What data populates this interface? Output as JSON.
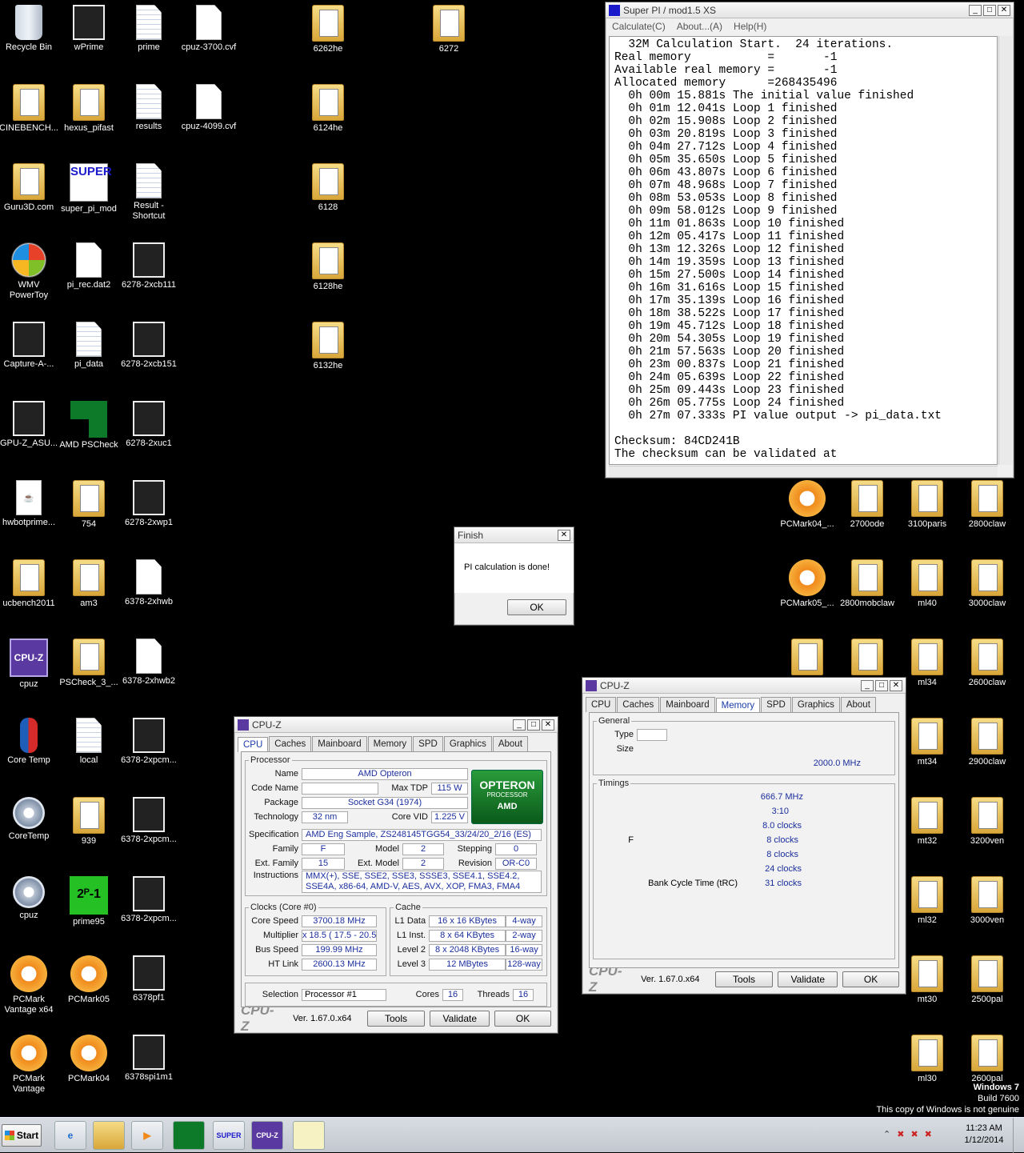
{
  "desktop": {
    "icons": [
      {
        "label": "Recycle Bin",
        "icon": "recycle-bin-icon"
      },
      {
        "label": "wPrime",
        "icon": "wprime-icon"
      },
      {
        "label": "prime",
        "icon": "text-file-icon"
      },
      {
        "label": "cpuz-3700.cvf",
        "icon": "file-icon"
      },
      {
        "label": "6262he",
        "icon": "folder-icon"
      },
      {
        "label": "6272",
        "icon": "folder-icon"
      },
      {
        "label": "CINEBENCH...",
        "icon": "folder-icon"
      },
      {
        "label": "hexus_pifast",
        "icon": "folder-icon"
      },
      {
        "label": "results",
        "icon": "text-file-icon"
      },
      {
        "label": "cpuz-4099.cvf",
        "icon": "file-icon"
      },
      {
        "label": "6124he",
        "icon": "folder-icon"
      },
      {
        "label": "Guru3D.com",
        "icon": "folder-icon"
      },
      {
        "label": "super_pi_mod",
        "icon": "super-pi-icon"
      },
      {
        "label": "Result - Shortcut",
        "icon": "shortcut-icon"
      },
      {
        "label": "6128",
        "icon": "folder-icon"
      },
      {
        "label": "WMV PowerToy",
        "icon": "windows-logo-icon"
      },
      {
        "label": "pi_rec.dat2",
        "icon": "file-icon"
      },
      {
        "label": "6278-2xcb111",
        "icon": "image-icon"
      },
      {
        "label": "6128he",
        "icon": "folder-icon"
      },
      {
        "label": "Capture-A-...",
        "icon": "capture-icon"
      },
      {
        "label": "pi_data",
        "icon": "text-file-icon"
      },
      {
        "label": "6278-2xcb151",
        "icon": "image-icon"
      },
      {
        "label": "6132he",
        "icon": "folder-icon"
      },
      {
        "label": "GPU-Z_ASU...",
        "icon": "gpuz-icon"
      },
      {
        "label": "AMD PSCheck",
        "icon": "amd-icon"
      },
      {
        "label": "6278-2xuc1",
        "icon": "image-icon"
      },
      {
        "label": "hwbotprime...",
        "icon": "java-icon"
      },
      {
        "label": "754",
        "icon": "folder-icon"
      },
      {
        "label": "6278-2xwp1",
        "icon": "image-icon"
      },
      {
        "label": "ucbench2011",
        "icon": "folder-icon"
      },
      {
        "label": "am3",
        "icon": "folder-icon"
      },
      {
        "label": "6378-2xhwb",
        "icon": "file-icon"
      },
      {
        "label": "cpuz",
        "icon": "cpuz-icon"
      },
      {
        "label": "PSCheck_3_...",
        "icon": "folder-icon"
      },
      {
        "label": "6378-2xhwb2",
        "icon": "file-icon"
      },
      {
        "label": "Core Temp",
        "icon": "thermometer-icon"
      },
      {
        "label": "local",
        "icon": "text-file-icon"
      },
      {
        "label": "6378-2xpcm...",
        "icon": "image-icon"
      },
      {
        "label": "CoreTemp",
        "icon": "gear-icon"
      },
      {
        "label": "939",
        "icon": "folder-icon"
      },
      {
        "label": "6378-2xpcm...",
        "icon": "image-icon"
      },
      {
        "label": "cpuz",
        "icon": "gear-icon"
      },
      {
        "label": "prime95",
        "icon": "prime95-icon"
      },
      {
        "label": "6378-2xpcm...",
        "icon": "image-icon"
      },
      {
        "label": "PCMark Vantage x64",
        "icon": "pcmark-icon"
      },
      {
        "label": "PCMark05",
        "icon": "pcmark-icon"
      },
      {
        "label": "6378pf1",
        "icon": "image-icon"
      },
      {
        "label": "PCMark Vantage",
        "icon": "pcmark-icon"
      },
      {
        "label": "PCMark04",
        "icon": "pcmark-icon"
      },
      {
        "label": "6378spi1m1",
        "icon": "image-icon"
      },
      {
        "label": "PCMark04_...",
        "icon": "pcmark-icon"
      },
      {
        "label": "2700ode",
        "icon": "folder-icon"
      },
      {
        "label": "3100paris",
        "icon": "folder-icon"
      },
      {
        "label": "2800claw",
        "icon": "folder-icon"
      },
      {
        "label": "PCMark05_...",
        "icon": "pcmark-icon"
      },
      {
        "label": "2800mobclaw",
        "icon": "folder-icon"
      },
      {
        "label": "ml40",
        "icon": "folder-icon"
      },
      {
        "label": "3000claw",
        "icon": "folder-icon"
      },
      {
        "label": "ml34",
        "icon": "folder-icon"
      },
      {
        "label": "2600claw",
        "icon": "folder-icon"
      },
      {
        "label": "mt34",
        "icon": "folder-icon"
      },
      {
        "label": "2900claw",
        "icon": "folder-icon"
      },
      {
        "label": "mt32",
        "icon": "folder-icon"
      },
      {
        "label": "3200ven",
        "icon": "folder-icon"
      },
      {
        "label": "ml32",
        "icon": "folder-icon"
      },
      {
        "label": "3000ven",
        "icon": "folder-icon"
      },
      {
        "label": "mt30",
        "icon": "folder-icon"
      },
      {
        "label": "2500pal",
        "icon": "folder-icon"
      },
      {
        "label": "ml30",
        "icon": "folder-icon"
      },
      {
        "label": "2600pal",
        "icon": "folder-icon"
      },
      {
        "label": "",
        "icon": "folder-icon"
      },
      {
        "label": "",
        "icon": "folder-icon"
      }
    ],
    "watermark": {
      "line1": "Windows 7",
      "line2": "Build 7600",
      "line3": "This copy of Windows is not genuine"
    }
  },
  "superpi": {
    "title": "Super PI / mod1.5 XS",
    "menu": [
      "Calculate(C)",
      "About...(A)",
      "Help(H)"
    ],
    "lines": [
      "  32M Calculation Start.  24 iterations.",
      "Real memory           =       -1",
      "Available real memory =       -1",
      "Allocated memory      =268435496",
      "  0h 00m 15.881s The initial value finished",
      "  0h 01m 12.041s Loop 1 finished",
      "  0h 02m 15.908s Loop 2 finished",
      "  0h 03m 20.819s Loop 3 finished",
      "  0h 04m 27.712s Loop 4 finished",
      "  0h 05m 35.650s Loop 5 finished",
      "  0h 06m 43.807s Loop 6 finished",
      "  0h 07m 48.968s Loop 7 finished",
      "  0h 08m 53.053s Loop 8 finished",
      "  0h 09m 58.012s Loop 9 finished",
      "  0h 11m 01.863s Loop 10 finished",
      "  0h 12m 05.417s Loop 11 finished",
      "  0h 13m 12.326s Loop 12 finished",
      "  0h 14m 19.359s Loop 13 finished",
      "  0h 15m 27.500s Loop 14 finished",
      "  0h 16m 31.616s Loop 15 finished",
      "  0h 17m 35.139s Loop 16 finished",
      "  0h 18m 38.522s Loop 17 finished",
      "  0h 19m 45.712s Loop 18 finished",
      "  0h 20m 54.305s Loop 19 finished",
      "  0h 21m 57.563s Loop 20 finished",
      "  0h 23m 00.837s Loop 21 finished",
      "  0h 24m 05.639s Loop 22 finished",
      "  0h 25m 09.443s Loop 23 finished",
      "  0h 26m 05.775s Loop 24 finished",
      "  0h 27m 07.333s PI value output -> pi_data.txt",
      "",
      "Checksum: 84CD241B",
      "The checksum can be validated at"
    ]
  },
  "finish": {
    "title": "Finish",
    "message": "PI calculation is done!",
    "ok": "OK"
  },
  "cpuz1": {
    "title": "CPU-Z",
    "tabs": [
      "CPU",
      "Caches",
      "Mainboard",
      "Memory",
      "SPD",
      "Graphics",
      "About"
    ],
    "processor_legend": "Processor",
    "name_l": "Name",
    "name": "AMD Opteron",
    "codename_l": "Code Name",
    "codename": "",
    "tdp_l": "Max TDP",
    "tdp": "115 W",
    "package_l": "Package",
    "package": "Socket G34 (1974)",
    "tech_l": "Technology",
    "tech": "32 nm",
    "vid_l": "Core VID",
    "vid": "1.225 V",
    "spec_l": "Specification",
    "spec": "AMD Eng Sample, ZS248145TGG54_33/24/20_2/16    (ES)",
    "family_l": "Family",
    "family": "F",
    "model_l": "Model",
    "model": "2",
    "stepping_l": "Stepping",
    "stepping": "0",
    "extfamily_l": "Ext. Family",
    "extfamily": "15",
    "extmodel_l": "Ext. Model",
    "extmodel": "2",
    "revision_l": "Revision",
    "revision": "OR-C0",
    "instr_l": "Instructions",
    "instr": "MMX(+), SSE, SSE2, SSE3, SSSE3, SSE4.1, SSE4.2, SSE4A, x86-64, AMD-V, AES, AVX, XOP, FMA3, FMA4",
    "badge_top": "OPTERON",
    "badge_mid": "PROCESSOR",
    "badge_amd": "AMD",
    "clocks_legend": "Clocks (Core #0)",
    "speed_l": "Core Speed",
    "speed": "3700.18 MHz",
    "mult_l": "Multiplier",
    "mult": "x 18.5 ( 17.5 - 20.5 )",
    "bus_l": "Bus Speed",
    "bus": "199.99 MHz",
    "ht_l": "HT Link",
    "ht": "2600.13 MHz",
    "cache_legend": "Cache",
    "l1d_l": "L1 Data",
    "l1d": "16 x 16 KBytes",
    "l1d_w": "4-way",
    "l1i_l": "L1 Inst.",
    "l1i": "8 x 64 KBytes",
    "l1i_w": "2-way",
    "l2_l": "Level 2",
    "l2": "8 x 2048 KBytes",
    "l2_w": "16-way",
    "l3_l": "Level 3",
    "l3": "12 MBytes",
    "l3_w": "128-way",
    "sel_l": "Selection",
    "sel": "Processor #1",
    "cores_l": "Cores",
    "cores": "16",
    "threads_l": "Threads",
    "threads": "16",
    "logo": "CPU-Z",
    "ver": "Ver. 1.67.0.x64",
    "tools": "Tools",
    "validate": "Validate",
    "ok": "OK"
  },
  "cpuz2": {
    "title": "CPU-Z",
    "tabs": [
      "CPU",
      "Caches",
      "Mainboard",
      "Memory",
      "SPD",
      "Graphics",
      "About"
    ],
    "general_legend": "General",
    "type_l": "Type",
    "size_l": "Size",
    "nb_freq": "2000.0 MHz",
    "timings_legend": "Timings",
    "dram_freq": "666.7 MHz",
    "ratio": "3:10",
    "cl": "8.0 clocks",
    "f_label": "F",
    "trcd": "8 clocks",
    "trp": "8 clocks",
    "tras": "24 clocks",
    "trc_l": "Bank Cycle Time (tRC)",
    "trc": "31 clocks",
    "logo": "CPU-Z",
    "ver": "Ver. 1.67.0.x64",
    "tools": "Tools",
    "validate": "Validate",
    "ok": "OK"
  },
  "taskbar": {
    "start": "Start",
    "time": "11:23 AM",
    "date": "1/12/2014",
    "apps": [
      "ie-icon",
      "explorer-icon",
      "media-player-icon",
      "amd-pscheck-icon",
      "super-pi-icon",
      "cpuz-icon",
      "capture-icon"
    ],
    "sp_label": "SUPER",
    "cpuz_label": "CPU-Z"
  }
}
